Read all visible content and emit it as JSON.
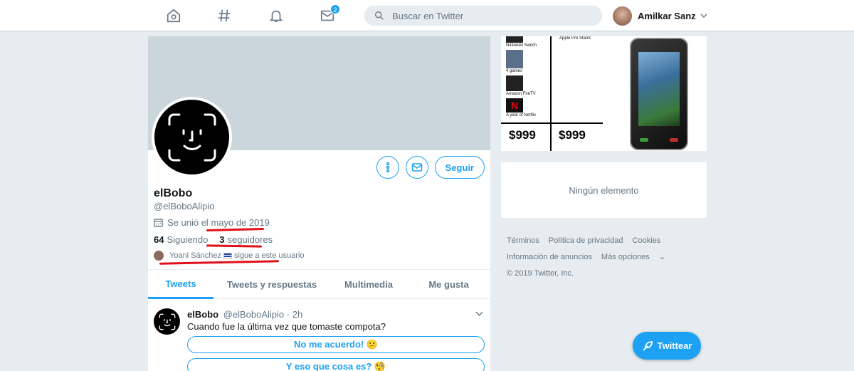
{
  "nav": {
    "icons": [
      "home-icon",
      "hashtag-icon",
      "notifications-icon",
      "messages-icon"
    ],
    "messages_badge": "2",
    "search_placeholder": "Buscar en Twitter",
    "user_name": "Amilkar Sanz"
  },
  "profile": {
    "name": "elBobo",
    "handle": "@elBoboAlipio",
    "joined_prefix": "Se unió el",
    "joined_date": "mayo de 2019",
    "following_count": "64",
    "following_label": "Siguiendo",
    "followers_count": "3",
    "followers_label": "seguidores",
    "followed_by_name": "Yoani Sánchez",
    "followed_by_suffix": "sigue a este usuario",
    "follow_label": "Seguir",
    "annotation_color": "#e0101a"
  },
  "tabs": [
    "Tweets",
    "Tweets y respuestas",
    "Multimedia",
    "Me gusta"
  ],
  "tweet": {
    "name": "elBobo",
    "handle": "@elBoboAlipio",
    "time": "· 2h",
    "text": "Cuando fue la última vez que tomaste compota?",
    "poll_options": [
      "No me acuerdo! 😕",
      "Y eso que cosa es? 🧐"
    ]
  },
  "ad": {
    "items": [
      "Nintendo Switch",
      "4 games",
      "Amazon FireTV",
      "A year of Netflix"
    ],
    "stand_label": "Apple Pro Stand",
    "price_left": "$999",
    "price_right": "$999"
  },
  "sidebar": {
    "empty_label": "Ningún elemento",
    "footer_links": [
      "Términos",
      "Política de privacidad",
      "Cookies",
      "Información de anuncios",
      "Más opciones"
    ],
    "copyright": "© 2019 Twitter, Inc."
  },
  "compose_label": "Twittear",
  "colors": {
    "accent": "#1da1f2",
    "background": "#e6ecf0",
    "muted": "#657786"
  }
}
